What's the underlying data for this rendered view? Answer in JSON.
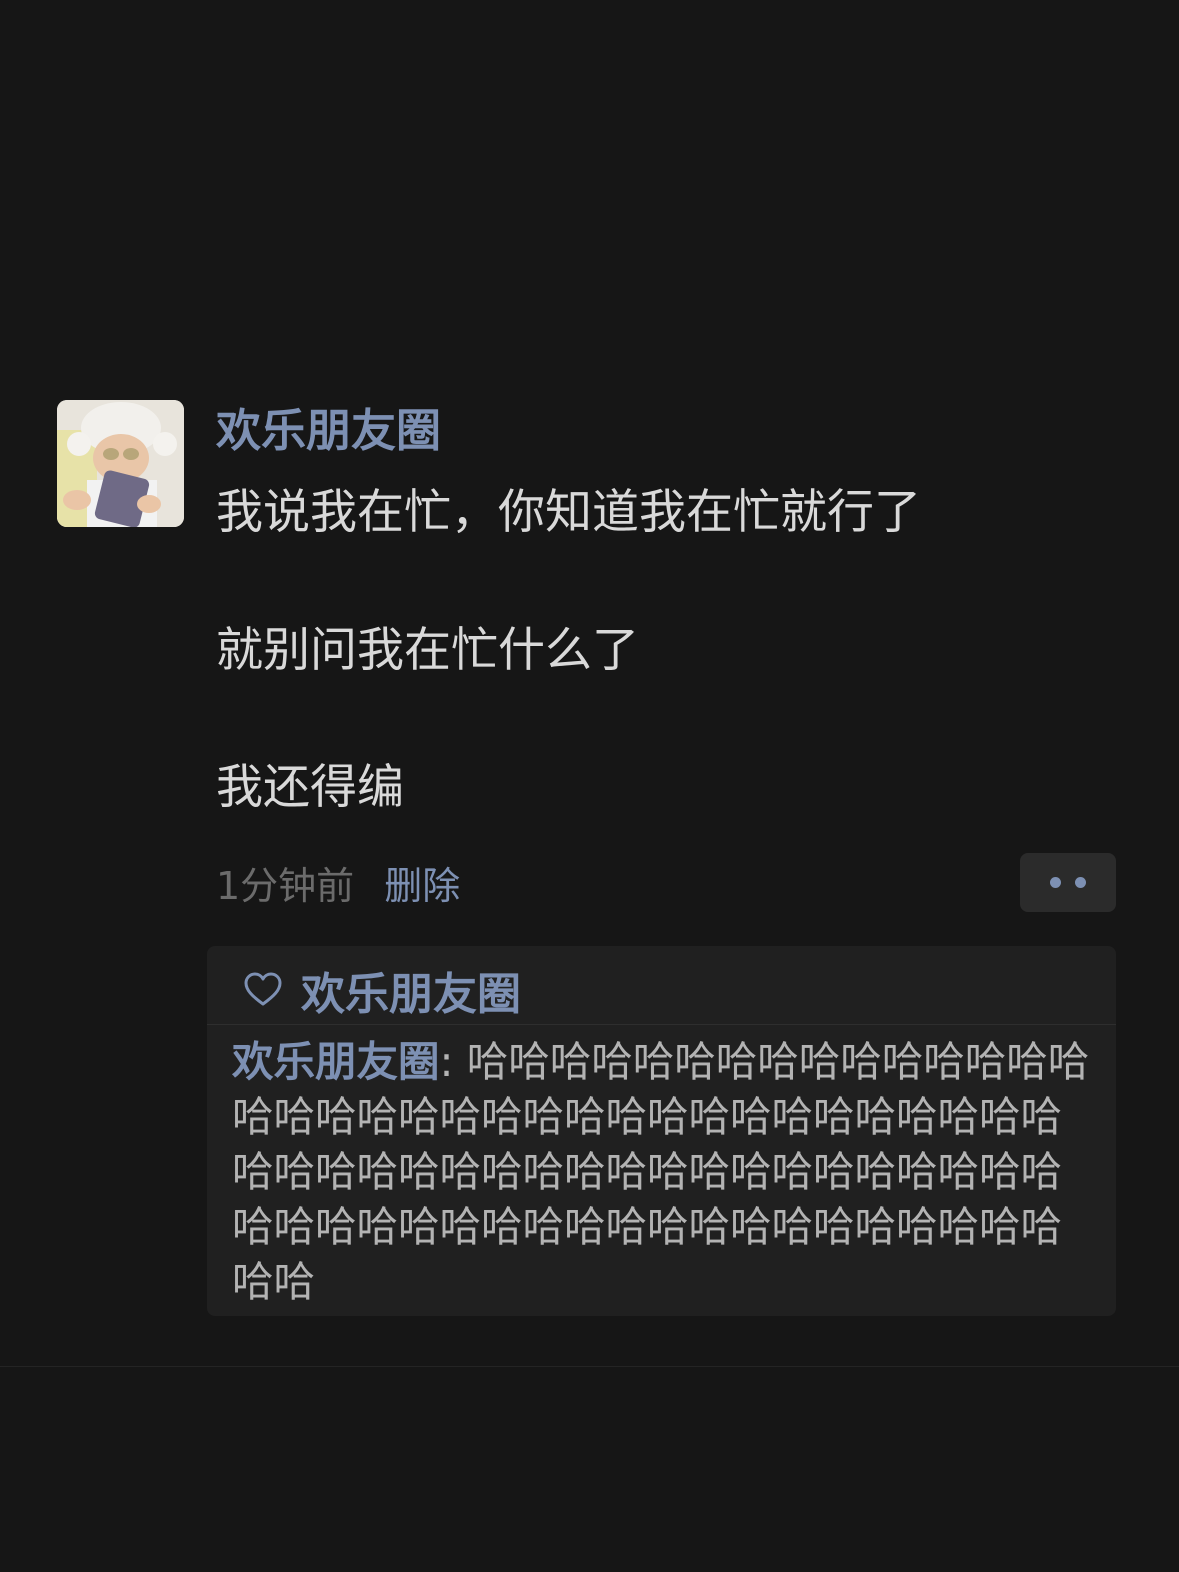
{
  "post": {
    "author": "欢乐朋友圈",
    "lines": [
      "我说我在忙，你知道我在忙就行了",
      "就别问我在忙什么了",
      "我还得编"
    ],
    "time": "1分钟前",
    "delete_label": "删除"
  },
  "likes": {
    "icon": "heart-icon",
    "names": "欢乐朋友圈"
  },
  "comment": {
    "commenter": "欢乐朋友圈",
    "separator": ": ",
    "text": "哈哈哈哈哈哈哈哈哈哈哈哈哈哈哈哈哈哈哈哈哈哈哈哈哈哈哈哈哈哈哈哈哈哈哈哈哈哈哈哈哈哈哈哈哈哈哈哈哈哈哈哈哈哈哈哈哈哈哈哈哈哈哈哈哈哈哈哈哈哈哈哈哈哈哈哈哈"
  },
  "colors": {
    "background": "#161616",
    "accent": "#7d90b3",
    "text": "#d9d9d9",
    "muted": "#6b6b6b"
  }
}
